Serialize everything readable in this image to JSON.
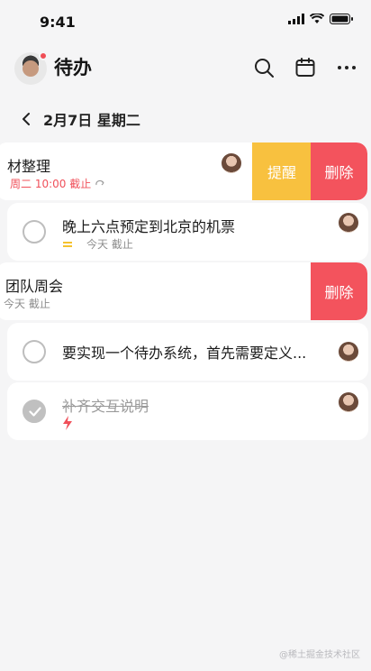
{
  "status_bar": {
    "time": "9:41"
  },
  "header": {
    "title": "待办"
  },
  "date_nav": {
    "label": "2月7日 星期二"
  },
  "tasks": [
    {
      "title": "材整理",
      "meta": "周二 10:00 截止",
      "meta_color": "#f0505a",
      "actions": [
        "提醒",
        "删除"
      ],
      "done": false
    },
    {
      "title": "晚上六点预定到北京的机票",
      "meta": "今天 截止",
      "done": false
    },
    {
      "title": "团队周会",
      "meta": "今天 截止",
      "actions": [
        "删除"
      ],
      "done": false
    },
    {
      "title": "要实现一个待办系统，首先需要定义...",
      "done": false
    },
    {
      "title": "补齐交互说明",
      "done": true
    }
  ],
  "watermark": "@稀土掘金技术社区",
  "colors": {
    "remind": "#f8c13f",
    "delete": "#f3535d",
    "accent_red": "#f0505a"
  }
}
